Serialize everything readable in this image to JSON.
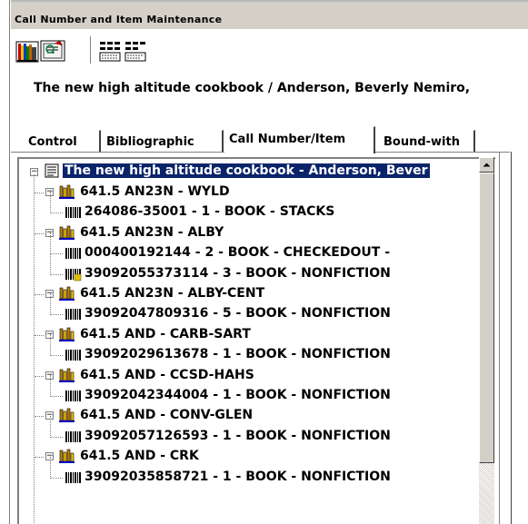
{
  "window": {
    "title": "Call Number and Item Maintenance"
  },
  "toolbar": {
    "buttons": [
      {
        "name": "bookshelf-icon"
      },
      {
        "name": "catalog-card-icon"
      },
      {
        "name": "table-grid-icon"
      },
      {
        "name": "list-view-icon"
      }
    ]
  },
  "record": {
    "title": "The new high altitude cookbook / Anderson, Beverly Nemiro,"
  },
  "tabs": [
    {
      "label": "Control"
    },
    {
      "label": "Bibliographic"
    },
    {
      "label": "Call Number/Item",
      "active": true
    },
    {
      "label": "Bound-with"
    }
  ],
  "tree": {
    "root": "The new high altitude cookbook - Anderson, Bever",
    "rows": [
      {
        "type": "callnum",
        "text": "641.5 AN23N - WYLD"
      },
      {
        "type": "item",
        "text": "264086-35001 - 1 - BOOK - STACKS"
      },
      {
        "type": "callnum",
        "text": "641.5 AN23N - ALBY"
      },
      {
        "type": "item",
        "text": "000400192144 - 2 - BOOK - CHECKEDOUT -"
      },
      {
        "type": "item-flag",
        "text": "39092055373114 - 3 - BOOK - NONFICTION"
      },
      {
        "type": "callnum",
        "text": "641.5 AN23N - ALBY-CENT"
      },
      {
        "type": "item",
        "text": "39092047809316 - 5 - BOOK - NONFICTION"
      },
      {
        "type": "callnum",
        "text": "641.5 AND - CARB-SART"
      },
      {
        "type": "item",
        "text": "39092029613678 - 1 - BOOK - NONFICTION"
      },
      {
        "type": "callnum",
        "text": "641.5 AND - CCSD-HAHS"
      },
      {
        "type": "item",
        "text": "39092042344004 - 1 - BOOK - NONFICTION"
      },
      {
        "type": "callnum",
        "text": "641.5 AND - CONV-GLEN"
      },
      {
        "type": "item",
        "text": "39092057126593 - 1 - BOOK - NONFICTION"
      },
      {
        "type": "callnum",
        "text": "641.5 AND - CRK"
      },
      {
        "type": "item",
        "text": "39092035858721 - 1 - BOOK - NONFICTION"
      }
    ]
  },
  "colors": {
    "selection": "#0a246a",
    "chrome": "#d4d0c8"
  }
}
